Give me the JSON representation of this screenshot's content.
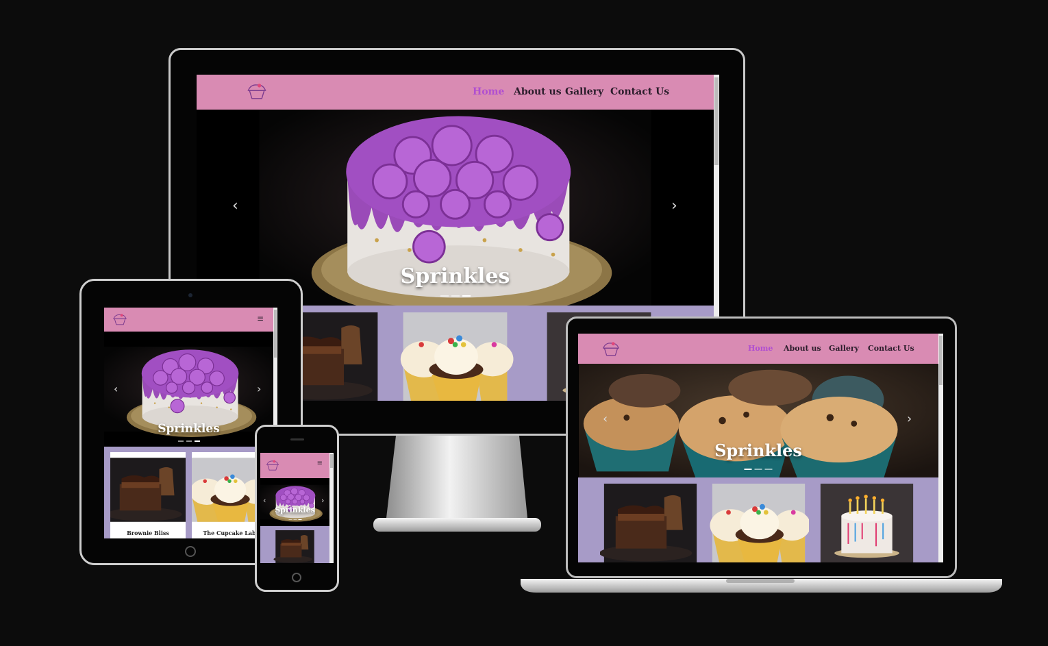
{
  "brand": {
    "name": "Sprinkles",
    "colors": {
      "nav": "#d98bb3",
      "active": "#b04fd0",
      "gallery": "#a79bc7",
      "background": "#0c0c0c"
    }
  },
  "nav": {
    "home": "Home",
    "about": "About us",
    "gallery": "Gallery",
    "contact": "Contact Us"
  },
  "hero": {
    "title": "Sprinkles"
  },
  "gallery": {
    "cards": [
      "Brownie Bliss",
      "The Cupcake Lab"
    ]
  },
  "icons": {
    "menu": "hamburger-icon",
    "prev": "chevron-left-icon",
    "next": "chevron-right-icon",
    "logo": "cupcake-logo-icon"
  }
}
